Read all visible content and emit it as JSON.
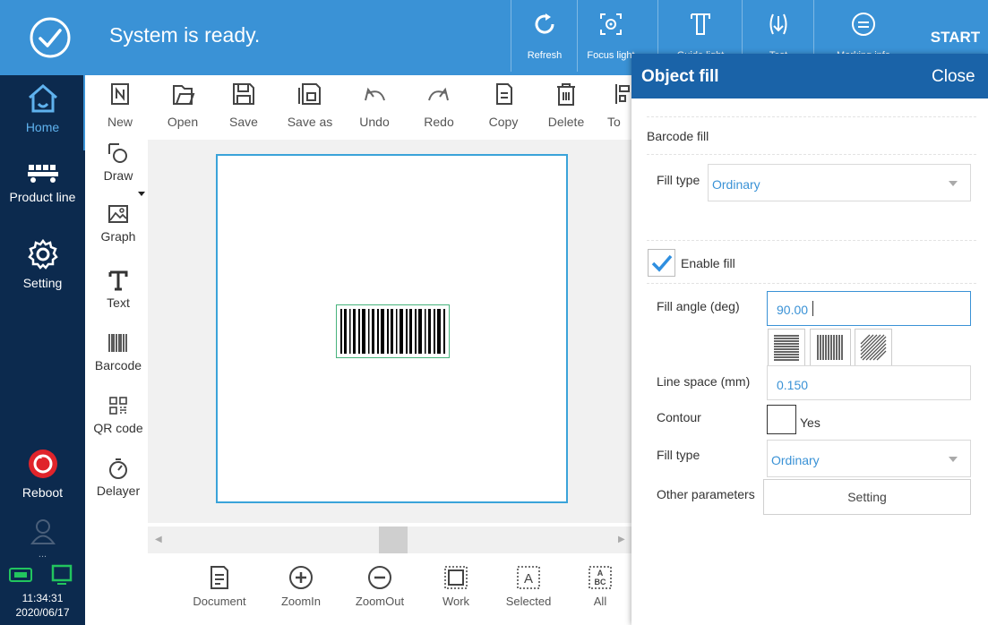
{
  "status": {
    "message": "System is ready."
  },
  "top_actions": [
    {
      "label": "Refresh",
      "icon": "refresh-icon"
    },
    {
      "label": "Focus light",
      "icon": "focus-light-icon"
    },
    {
      "label": "Guide light",
      "icon": "guide-light-icon"
    },
    {
      "label": "Test",
      "icon": "test-icon"
    },
    {
      "label": "Marking info",
      "icon": "info-icon"
    }
  ],
  "start_label": "START",
  "nav": {
    "home": "Home",
    "product_line": "Product line",
    "setting": "Setting",
    "reboot": "Reboot",
    "more": "...",
    "time": "11:34:31",
    "date": "2020/06/17"
  },
  "toolbar": {
    "new": "New",
    "open": "Open",
    "save": "Save",
    "save_as": "Save as",
    "undo": "Undo",
    "redo": "Redo",
    "copy": "Copy",
    "delete": "Delete",
    "to": "To"
  },
  "draw_tools": {
    "draw": "Draw",
    "graph": "Graph",
    "text": "Text",
    "barcode": "Barcode",
    "qr": "QR code",
    "delayer": "Delayer"
  },
  "bottom_tools": {
    "document": "Document",
    "zoomin": "ZoomIn",
    "zoomout": "ZoomOut",
    "work": "Work",
    "selected": "Selected",
    "all": "All"
  },
  "panel": {
    "title": "Object fill",
    "close": "Close",
    "section": "Barcode fill",
    "fill_type_label": "Fill type",
    "fill_type_value": "Ordinary",
    "enable_fill": "Enable fill",
    "fill_angle_label": "Fill angle (deg)",
    "fill_angle_value": "90.00",
    "line_space_label": "Line space (mm)",
    "line_space_value": "0.150",
    "contour_label": "Contour",
    "contour_yes": "Yes",
    "fill_type2_label": "Fill type",
    "fill_type2_value": "Ordinary",
    "other_label": "Other parameters",
    "other_button": "Setting"
  },
  "colors": {
    "accent": "#3a92d6",
    "nav_bg": "#0c2a4e",
    "panel_header": "#1a63a8"
  }
}
